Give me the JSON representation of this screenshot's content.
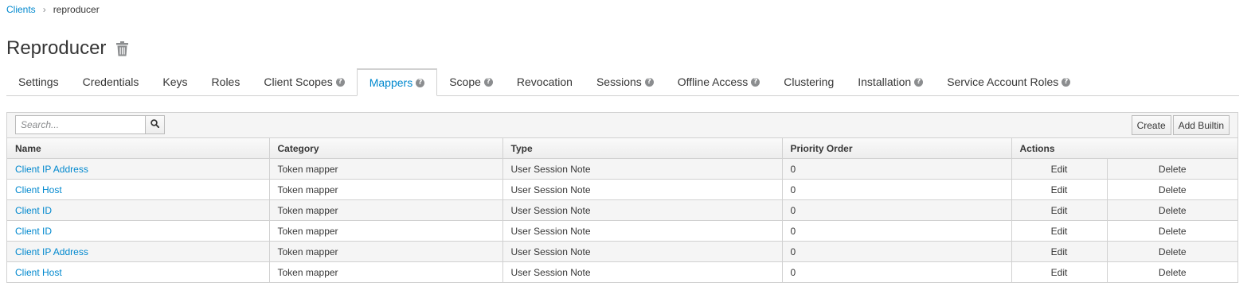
{
  "breadcrumb": {
    "parent": "Clients",
    "separator": "›",
    "current": "reproducer"
  },
  "page": {
    "title": "Reproducer"
  },
  "tabs": [
    {
      "label": "Settings",
      "help": false
    },
    {
      "label": "Credentials",
      "help": false
    },
    {
      "label": "Keys",
      "help": false
    },
    {
      "label": "Roles",
      "help": false
    },
    {
      "label": "Client Scopes",
      "help": true
    },
    {
      "label": "Mappers",
      "help": true,
      "active": true
    },
    {
      "label": "Scope",
      "help": true
    },
    {
      "label": "Revocation",
      "help": false
    },
    {
      "label": "Sessions",
      "help": true
    },
    {
      "label": "Offline Access",
      "help": true
    },
    {
      "label": "Clustering",
      "help": false
    },
    {
      "label": "Installation",
      "help": true
    },
    {
      "label": "Service Account Roles",
      "help": true
    }
  ],
  "toolbar": {
    "search_placeholder": "Search...",
    "create_label": "Create",
    "add_builtin_label": "Add Builtin"
  },
  "table": {
    "columns": [
      "Name",
      "Category",
      "Type",
      "Priority Order",
      "Actions"
    ],
    "rows": [
      {
        "name": "Client IP Address",
        "category": "Token mapper",
        "type": "User Session Note",
        "priority": "0",
        "edit": "Edit",
        "delete": "Delete"
      },
      {
        "name": "Client Host",
        "category": "Token mapper",
        "type": "User Session Note",
        "priority": "0",
        "edit": "Edit",
        "delete": "Delete"
      },
      {
        "name": "Client ID",
        "category": "Token mapper",
        "type": "User Session Note",
        "priority": "0",
        "edit": "Edit",
        "delete": "Delete"
      },
      {
        "name": "Client ID",
        "category": "Token mapper",
        "type": "User Session Note",
        "priority": "0",
        "edit": "Edit",
        "delete": "Delete"
      },
      {
        "name": "Client IP Address",
        "category": "Token mapper",
        "type": "User Session Note",
        "priority": "0",
        "edit": "Edit",
        "delete": "Delete"
      },
      {
        "name": "Client Host",
        "category": "Token mapper",
        "type": "User Session Note",
        "priority": "0",
        "edit": "Edit",
        "delete": "Delete"
      }
    ]
  },
  "icons": {
    "delete_client": "trash-icon",
    "search": "search-icon",
    "help": "question-circle-icon"
  },
  "colors": {
    "link": "#0088ce",
    "text": "#363636",
    "border": "#d1d1d1"
  }
}
